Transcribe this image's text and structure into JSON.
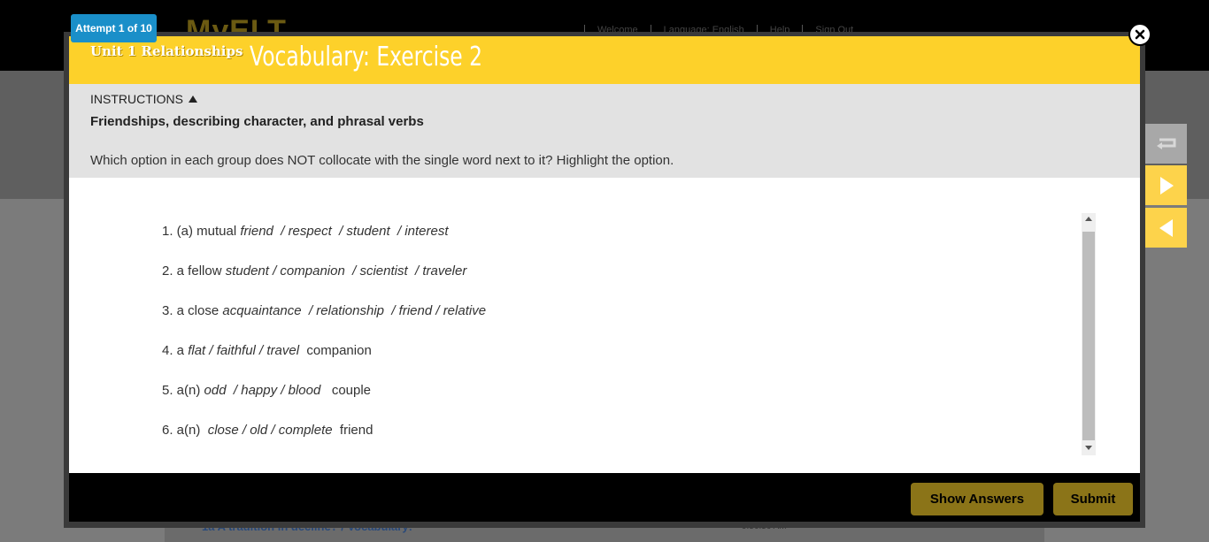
{
  "background": {
    "logo": "MyELT",
    "top_nav": [
      "Welcome",
      "Language: English",
      "Help",
      "Sign Out"
    ],
    "bottom_link": "1a A tradition in decline? / Vocabulary:",
    "bottom_time": "9:56:56 AM"
  },
  "attempt": {
    "label": "Attempt 1 of 10"
  },
  "header": {
    "unit": "Unit 1 Relationships",
    "title": "Vocabulary: Exercise 2",
    "color": "#fdd12a"
  },
  "instructions": {
    "toggle_label": "INSTRUCTIONS",
    "heading": "Friendships, describing character, and phrasal verbs",
    "text": "Which option in each group does NOT collocate with the single word next to it? Highlight the option."
  },
  "items": [
    {
      "prefix": "1. (a) mutual ",
      "options": "friend  / respect  / student  / interest",
      "suffix": ""
    },
    {
      "prefix": "2. a fellow ",
      "options": "student / companion  / scientist  / traveler",
      "suffix": ""
    },
    {
      "prefix": "3. a close ",
      "options": "acquaintance  / relationship  / friend / relative",
      "suffix": ""
    },
    {
      "prefix": "4. a ",
      "options": "flat / faithful / travel",
      "suffix": "  companion"
    },
    {
      "prefix": "5. a(n) ",
      "options": "odd  / happy / blood",
      "suffix": "   couple"
    },
    {
      "prefix": "6. a(n)  ",
      "options": "close / old / complete",
      "suffix": "  friend"
    }
  ],
  "footer": {
    "show_answers_label": "Show Answers",
    "submit_label": "Submit"
  },
  "icons": {
    "close": "close-icon",
    "back": "return-arrow-icon",
    "next": "play-right-icon",
    "prev": "play-left-icon"
  }
}
